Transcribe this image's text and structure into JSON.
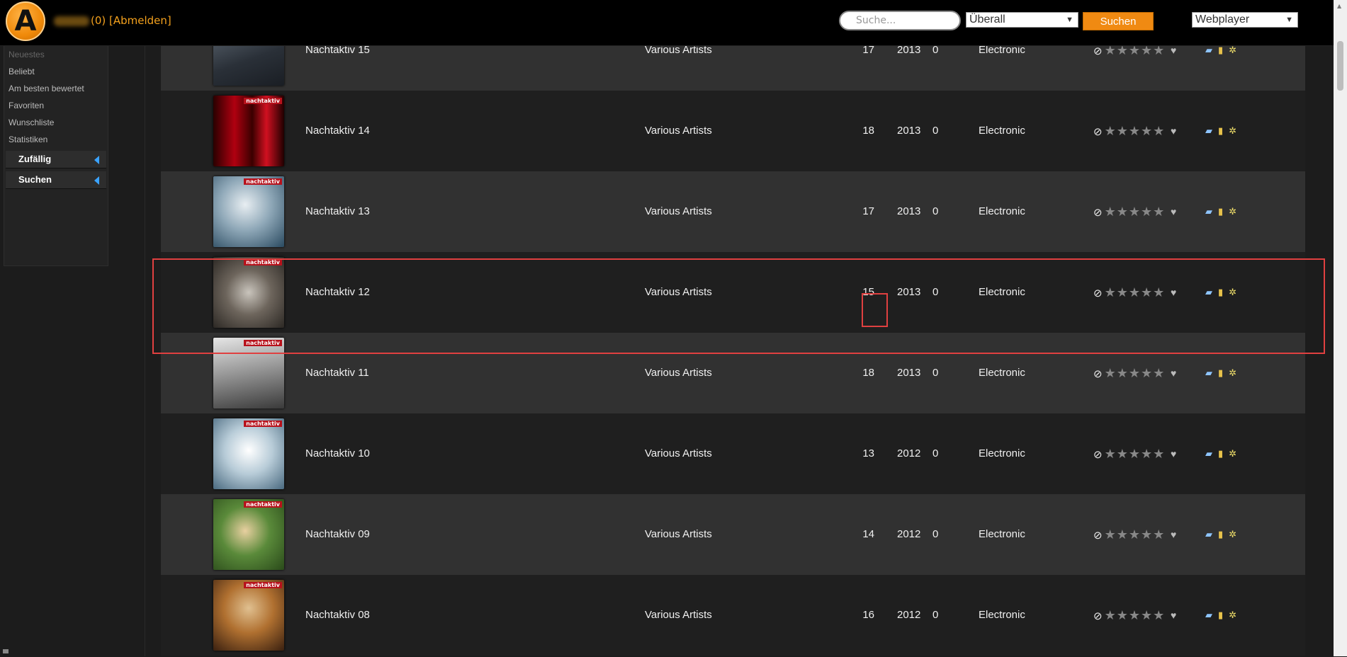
{
  "header": {
    "logo_letter": "A",
    "user_suffix": "(0) [Abmelden]",
    "search_placeholder": "Suche...",
    "scope_select_value": "Überall",
    "search_button": "Suchen",
    "player_select_value": "Webplayer"
  },
  "sidebar": {
    "items": [
      "Neuestes",
      "Beliebt",
      "Am besten bewertet",
      "Favoriten",
      "Wunschliste",
      "Statistiken"
    ],
    "sections": [
      "Zufällig",
      "Suchen"
    ]
  },
  "albums": [
    {
      "title": "Nachtaktiv 15",
      "artist": "Various Artists",
      "tracks": "17",
      "year": "2013",
      "count": "0",
      "genre": "Electronic"
    },
    {
      "title": "Nachtaktiv 14",
      "artist": "Various Artists",
      "tracks": "18",
      "year": "2013",
      "count": "0",
      "genre": "Electronic"
    },
    {
      "title": "Nachtaktiv 13",
      "artist": "Various Artists",
      "tracks": "17",
      "year": "2013",
      "count": "0",
      "genre": "Electronic"
    },
    {
      "title": "Nachtaktiv 12",
      "artist": "Various Artists",
      "tracks": "15",
      "year": "2013",
      "count": "0",
      "genre": "Electronic"
    },
    {
      "title": "Nachtaktiv 11",
      "artist": "Various Artists",
      "tracks": "18",
      "year": "2013",
      "count": "0",
      "genre": "Electronic"
    },
    {
      "title": "Nachtaktiv 10",
      "artist": "Various Artists",
      "tracks": "13",
      "year": "2012",
      "count": "0",
      "genre": "Electronic"
    },
    {
      "title": "Nachtaktiv 09",
      "artist": "Various Artists",
      "tracks": "14",
      "year": "2012",
      "count": "0",
      "genre": "Electronic"
    },
    {
      "title": "Nachtaktiv 08",
      "artist": "Various Artists",
      "tracks": "16",
      "year": "2012",
      "count": "0",
      "genre": "Electronic"
    }
  ],
  "cover_badge": "nachtaktiv",
  "icons": {
    "no_rating": "ban-icon",
    "stars": "star-icon",
    "favorite": "heart-icon",
    "actions": [
      "comment-icon",
      "pdf-icon",
      "settings-icon"
    ]
  },
  "colors": {
    "accent_orange": "#f08a12",
    "highlight_red": "#e04040",
    "row_light": "#313131",
    "row_dark": "#1f1f1f"
  }
}
